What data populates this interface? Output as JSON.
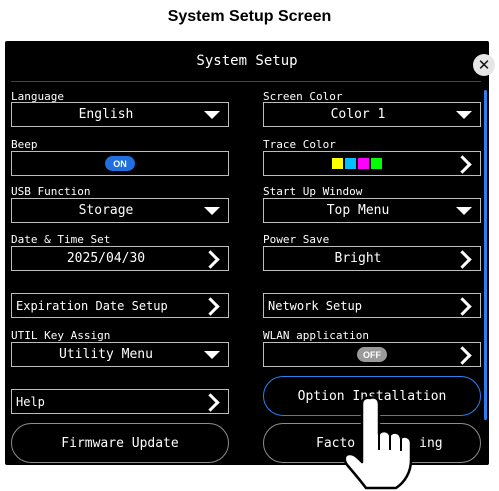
{
  "caption": "System Setup Screen",
  "window": {
    "title": "System Setup"
  },
  "left": {
    "language": {
      "label": "Language",
      "value": "English"
    },
    "beep": {
      "label": "Beep",
      "toggle": "ON"
    },
    "usb": {
      "label": "USB Function",
      "value": "Storage"
    },
    "datetime": {
      "label": "Date & Time Set",
      "value": "2025/04/30"
    },
    "expiration": {
      "label": "Expiration Date Setup"
    },
    "utilkey": {
      "label": "UTIL Key Assign",
      "value": "Utility Menu"
    },
    "help": {
      "label": "Help"
    },
    "firmware": {
      "label": "Firmware Update"
    }
  },
  "right": {
    "screen_color": {
      "label": "Screen Color",
      "value": "Color 1"
    },
    "trace_color": {
      "label": "Trace Color",
      "swatches": [
        "#ffff00",
        "#00bfff",
        "#ff00ff",
        "#00ff00"
      ]
    },
    "startup": {
      "label": "Start Up Window",
      "value": "Top Menu"
    },
    "power_save": {
      "label": "Power Save",
      "value": "Bright"
    },
    "network": {
      "label": "Network Setup"
    },
    "wlan": {
      "label": "WLAN application",
      "toggle": "OFF"
    },
    "option": {
      "label": "Option Installation"
    },
    "factory": {
      "label_left": "Facto",
      "label_right": "ing"
    }
  },
  "colors": {
    "accent": "#2d7ff0",
    "background": "#000000",
    "border": "#bdbdbd"
  }
}
